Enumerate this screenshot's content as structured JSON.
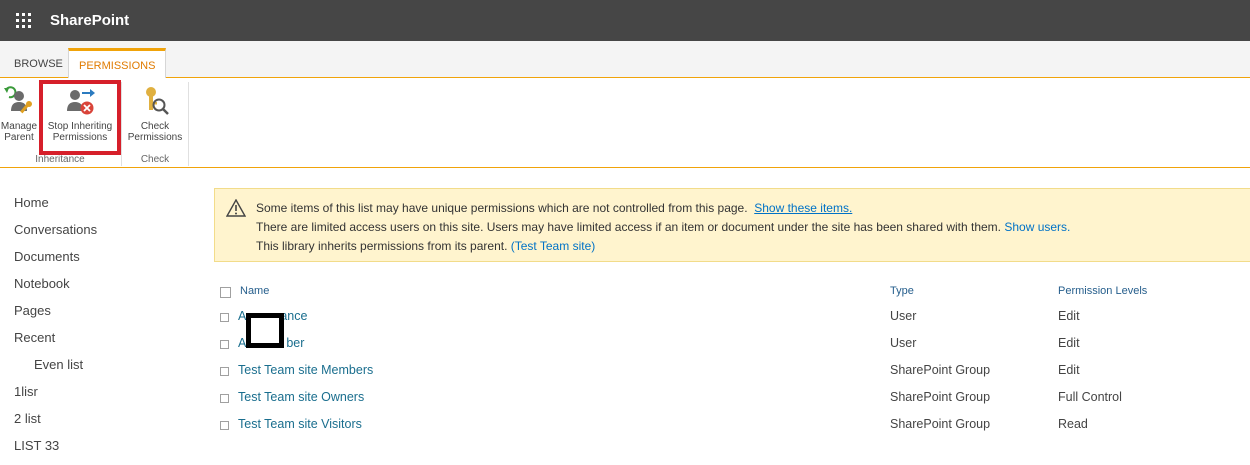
{
  "suite": {
    "app_name": "SharePoint",
    "waffle_icon": "app-launcher-icon"
  },
  "tabs": [
    {
      "label": "BROWSE"
    },
    {
      "label": "PERMISSIONS"
    }
  ],
  "ribbon": {
    "buttons": [
      {
        "line1": "Manage",
        "line2": "Parent",
        "icon": "manage-parent-icon"
      },
      {
        "line1": "Stop Inheriting",
        "line2": "Permissions",
        "icon": "stop-inheriting-icon"
      },
      {
        "line1": "Check",
        "line2": "Permissions",
        "icon": "check-permissions-icon"
      }
    ],
    "groups": [
      {
        "label": "Inheritance"
      },
      {
        "label": "Check"
      }
    ],
    "highlight_color": "#d61f2a",
    "accent_color": "#f0a30a"
  },
  "nav": {
    "items": [
      {
        "label": "Home"
      },
      {
        "label": "Conversations"
      },
      {
        "label": "Documents"
      },
      {
        "label": "Notebook"
      },
      {
        "label": "Pages"
      },
      {
        "label": "Recent"
      },
      {
        "label": "Even list"
      },
      {
        "label": "1lisr"
      },
      {
        "label": "2 list"
      },
      {
        "label": "LIST 33"
      }
    ]
  },
  "banner": {
    "line1_text": "Some items of this list may have unique permissions which are not controlled from this page.",
    "line1_link": "Show these items.",
    "line2_text": "There are limited access users on this site. Users may have limited access if an item or document under the site has been shared with them.",
    "line2_link": "Show users.",
    "line3_text": "This library inherits permissions from its parent.",
    "line3_link": "(Test Team site)",
    "background": "#fff4ce"
  },
  "table": {
    "headers": {
      "name": "Name",
      "type": "Type",
      "perm": "Permission Levels"
    },
    "rows": [
      {
        "name_start": "A",
        "name_end": "ance",
        "type": "User",
        "perm": "Edit"
      },
      {
        "name_start": "A",
        "name_end": "ber",
        "type": "User",
        "perm": "Edit"
      },
      {
        "name": "Test Team site Members",
        "type": "SharePoint Group",
        "perm": "Edit"
      },
      {
        "name": "Test Team site Owners",
        "type": "SharePoint Group",
        "perm": "Full Control"
      },
      {
        "name": "Test Team site Visitors",
        "type": "SharePoint Group",
        "perm": "Read"
      }
    ]
  }
}
